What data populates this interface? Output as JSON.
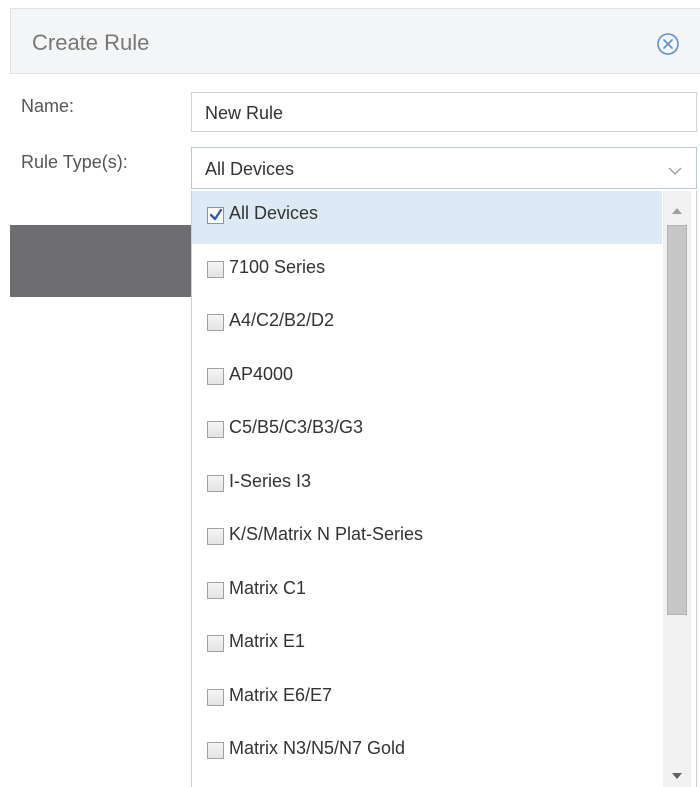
{
  "dialog": {
    "title": "Create Rule",
    "close_icon": "close-circle-icon"
  },
  "form": {
    "name_label": "Name:",
    "name_value": "New Rule",
    "rule_type_label": "Rule Type(s):",
    "rule_type_value": "All Devices"
  },
  "dropdown": {
    "items": [
      {
        "label": "All Devices",
        "checked": true
      },
      {
        "label": "7100 Series",
        "checked": false
      },
      {
        "label": "A4/C2/B2/D2",
        "checked": false
      },
      {
        "label": "AP4000",
        "checked": false
      },
      {
        "label": "C5/B5/C3/B3/G3",
        "checked": false
      },
      {
        "label": "I-Series I3",
        "checked": false
      },
      {
        "label": "K/S/Matrix N Plat-Series",
        "checked": false
      },
      {
        "label": "Matrix C1",
        "checked": false
      },
      {
        "label": "Matrix E1",
        "checked": false
      },
      {
        "label": "Matrix E6/E7",
        "checked": false
      },
      {
        "label": "Matrix N3/N5/N7 Gold",
        "checked": false
      }
    ]
  },
  "colors": {
    "accent": "#5b8fd6",
    "selected_row": "#dde9f5",
    "header_bg": "#f3f5f6"
  }
}
